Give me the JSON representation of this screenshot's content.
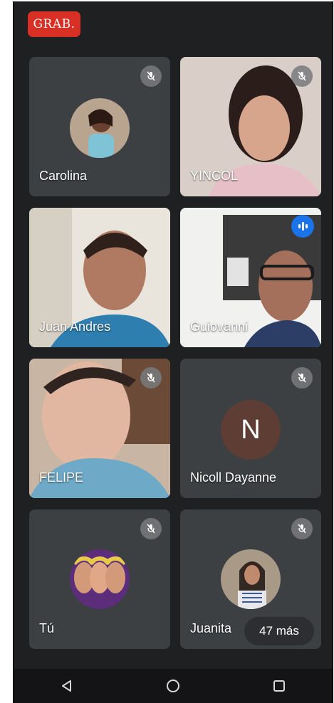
{
  "recording_badge": "GRAB.",
  "participants": [
    {
      "name": "Carolina",
      "muted": true,
      "type": "photo-avatar"
    },
    {
      "name": "YINCOL",
      "muted": true,
      "type": "video"
    },
    {
      "name": "Juan Andres",
      "muted": false,
      "type": "video"
    },
    {
      "name": "Guiovanni",
      "muted": false,
      "type": "video",
      "speaking": true
    },
    {
      "name": "FELIPE",
      "muted": true,
      "type": "video"
    },
    {
      "name": "Nicoll Dayanne",
      "muted": true,
      "type": "letter-avatar",
      "initial": "N"
    },
    {
      "name": "Tú",
      "muted": true,
      "type": "photo-avatar"
    },
    {
      "name": "Juanita",
      "muted": true,
      "type": "photo-avatar"
    }
  ],
  "more_participants": "47 más",
  "nav": {
    "back": "back-icon",
    "home": "home-icon",
    "recents": "recents-icon"
  }
}
